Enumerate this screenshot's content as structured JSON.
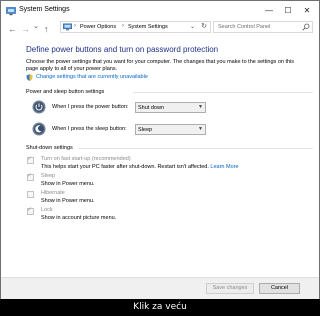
{
  "window": {
    "title": "System Settings",
    "controls": {
      "minimize": "—",
      "maximize": "☐",
      "close": "✕"
    }
  },
  "nav": {
    "back": "←",
    "forward": "→",
    "recent": "⌄",
    "up": "↑",
    "breadcrumb": [
      "Power Options",
      "System Settings"
    ],
    "breadcrumb_sep": "›",
    "search_placeholder": "Search Control Panel"
  },
  "main": {
    "heading": "Define power buttons and turn on password protection",
    "description": "Choose the power settings that you want for your computer. The changes that you make to the settings on this page apply to all of your power plans.",
    "change_unavailable_link": "Change settings that are currently unavailable",
    "power_sleep_section": {
      "title": "Power and sleep button settings",
      "rows": [
        {
          "label": "When I press the power button:",
          "value": "Shut down"
        },
        {
          "label": "When I press the sleep button:",
          "value": "Sleep"
        }
      ]
    },
    "shutdown_section": {
      "title": "Shut-down settings",
      "items": [
        {
          "label": "Turn on fast start-up (recommended)",
          "desc": "This helps start your PC faster after shut-down. Restart isn't affected.",
          "link": "Learn More",
          "checked": true
        },
        {
          "label": "Sleep",
          "desc": "Show in Power menu.",
          "checked": true
        },
        {
          "label": "Hibernate",
          "desc": "Show in Power menu.",
          "checked": false
        },
        {
          "label": "Lock",
          "desc": "Show in account picture menu.",
          "checked": true
        }
      ]
    }
  },
  "footer": {
    "save_label": "Save changes",
    "cancel_label": "Cancel"
  },
  "caption": "Klik za veću"
}
